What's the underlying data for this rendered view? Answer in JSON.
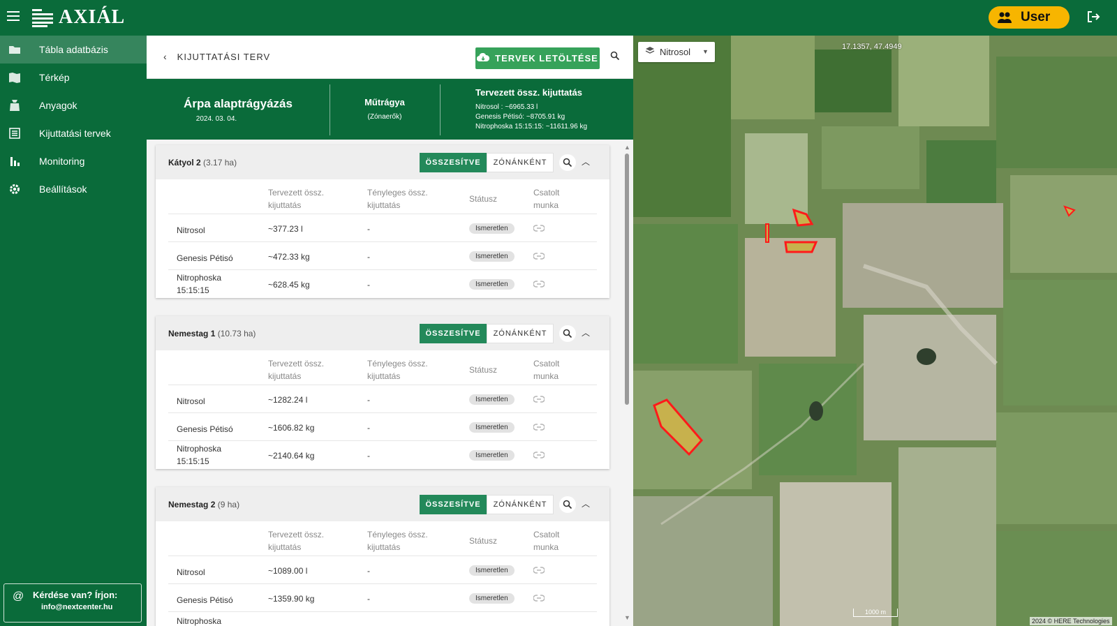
{
  "app": {
    "logo_text": "AXIÁL",
    "user_label": "User"
  },
  "sidebar": {
    "items": [
      {
        "label": "Tábla adatbázis",
        "icon": "folder-icon"
      },
      {
        "label": "Térkép",
        "icon": "map-icon"
      },
      {
        "label": "Anyagok",
        "icon": "bag-icon"
      },
      {
        "label": "Kijuttatási tervek",
        "icon": "list-icon"
      },
      {
        "label": "Monitoring",
        "icon": "bar-chart-icon"
      },
      {
        "label": "Beállítások",
        "icon": "gear-icon"
      }
    ],
    "help_title": "Kérdése van? Írjon:",
    "help_email": "info@nextcenter.hu"
  },
  "panel": {
    "back_label": "KIJUTTATÁSI TERV",
    "download_label": "TERVEK LETÖLTÉSE"
  },
  "summary": {
    "plan_title": "Árpa alaptrágyázás",
    "plan_date": "2024. 03. 04.",
    "type_title": "Műtrágya",
    "type_sub": "(Zónaerők)",
    "total_title": "Tervezett össz. kijuttatás",
    "totals": [
      "Nitrosol : ~6965.33 l",
      "Genesis Pétisó: ~8705.91 kg",
      "Nitrophoska 15:15:15: ~11611.96 kg"
    ]
  },
  "table_headers": {
    "planned_1": "Tervezett össz.",
    "planned_2": "kijuttatás",
    "actual_1": "Tényleges össz.",
    "actual_2": "kijuttatás",
    "status": "Státusz",
    "job_1": "Csatolt",
    "job_2": "munka"
  },
  "toggle": {
    "combined": "ÖSSZESÍTVE",
    "by_zone": "ZÓNÁNKÉNT"
  },
  "cards": [
    {
      "name": "Kátyol 2",
      "area": "(3.17 ha)",
      "rows": [
        {
          "material": "Nitrosol",
          "material_2": "",
          "planned": "~377.23 l",
          "actual": "-",
          "status": "Ismeretlen"
        },
        {
          "material": "Genesis Pétisó",
          "material_2": "",
          "planned": "~472.33 kg",
          "actual": "-",
          "status": "Ismeretlen"
        },
        {
          "material": "Nitrophoska",
          "material_2": "15:15:15",
          "planned": "~628.45 kg",
          "actual": "-",
          "status": "Ismeretlen"
        }
      ]
    },
    {
      "name": "Nemestag 1",
      "area": "(10.73 ha)",
      "rows": [
        {
          "material": "Nitrosol",
          "material_2": "",
          "planned": "~1282.24 l",
          "actual": "-",
          "status": "Ismeretlen"
        },
        {
          "material": "Genesis Pétisó",
          "material_2": "",
          "planned": "~1606.82 kg",
          "actual": "-",
          "status": "Ismeretlen"
        },
        {
          "material": "Nitrophoska",
          "material_2": "15:15:15",
          "planned": "~2140.64 kg",
          "actual": "-",
          "status": "Ismeretlen"
        }
      ]
    },
    {
      "name": "Nemestag 2",
      "area": "(9 ha)",
      "rows": [
        {
          "material": "Nitrosol",
          "material_2": "",
          "planned": "~1089.00 l",
          "actual": "-",
          "status": "Ismeretlen"
        },
        {
          "material": "Genesis Pétisó",
          "material_2": "",
          "planned": "~1359.90 kg",
          "actual": "-",
          "status": "Ismeretlen"
        },
        {
          "material": "Nitrophoska",
          "material_2": "",
          "planned": "",
          "actual": "",
          "status": ""
        }
      ]
    }
  ],
  "map": {
    "layer_select": "Nitrosol",
    "coords": "17.1357, 47.4949",
    "scale": "1000 m",
    "copyright": "2024 © HERE Technologies"
  },
  "colors": {
    "brand_green": "#0a6b3a",
    "accent_green": "#36a25a",
    "user_yellow": "#f7b500",
    "field_outline": "#ff1a1a"
  }
}
